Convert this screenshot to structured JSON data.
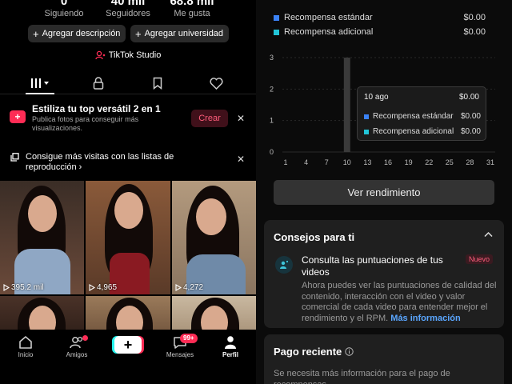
{
  "profile": {
    "stats": [
      {
        "value": "0",
        "label": "Siguiendo"
      },
      {
        "value": "40 mil",
        "label": "Seguidores"
      },
      {
        "value": "68.8 mil",
        "label": "Me gusta"
      }
    ],
    "add_description": "Agregar descripción",
    "add_university": "Agregar universidad",
    "studio_label": "TikTok Studio"
  },
  "promo": {
    "title": "Estiliza tu top versátil 2 en 1",
    "description": "Publica fotos para conseguir más visualizaciones.",
    "create_label": "Crear"
  },
  "playlist_banner": {
    "text": "Consigue más visitas con las listas de reproducción",
    "arrow": "›"
  },
  "videos": [
    {
      "views": "395.2 mil"
    },
    {
      "views": "4,965"
    },
    {
      "views": "4,272"
    },
    {
      "views": ""
    },
    {
      "views": ""
    },
    {
      "views": ""
    }
  ],
  "bottom_nav": {
    "items": [
      {
        "label": "Inicio",
        "icon": "home-icon"
      },
      {
        "label": "Amigos",
        "icon": "friends-icon"
      },
      {
        "label": "",
        "icon": "create-icon"
      },
      {
        "label": "Mensajes",
        "icon": "inbox-icon",
        "badge": "99+"
      },
      {
        "label": "Perfil",
        "icon": "profile-icon"
      }
    ]
  },
  "rewards": {
    "legend": [
      {
        "label": "Recompensa estándar",
        "value": "$0.00",
        "color": "#3b82f6"
      },
      {
        "label": "Recompensa adicional",
        "value": "$0.00",
        "color": "#22c5d8"
      }
    ],
    "tooltip": {
      "date": "10 ago",
      "total": "$0.00",
      "rows": [
        {
          "label": "Recompensa estándar",
          "value": "$0.00",
          "color": "#3b82f6"
        },
        {
          "label": "Recompensa adicional",
          "value": "$0.00",
          "color": "#22c5d8"
        }
      ]
    },
    "view_performance": "Ver rendimiento"
  },
  "chart_data": {
    "type": "bar",
    "x": [
      "1",
      "4",
      "7",
      "10",
      "13",
      "16",
      "19",
      "22",
      "25",
      "28",
      "31"
    ],
    "y_ticks": [
      "0",
      "1",
      "2",
      "3"
    ],
    "ylim": [
      0,
      3
    ],
    "series": [
      {
        "name": "Recompensa estándar",
        "values": [
          0,
          0,
          0,
          0,
          0,
          0,
          0,
          0,
          0,
          0,
          0
        ]
      },
      {
        "name": "Recompensa adicional",
        "values": [
          0,
          0,
          0,
          0,
          0,
          0,
          0,
          0,
          0,
          0,
          0
        ]
      }
    ],
    "highlighted_x": "10"
  },
  "tips": {
    "title": "Consejos para ti",
    "item_title": "Consulta las puntuaciones de tus videos",
    "new_badge": "Nuevo",
    "item_body": "Ahora puedes ver las puntuaciones de calidad del contenido, interacción con el video y valor comercial de cada video para entender mejor el rendimiento y el RPM.",
    "more_link": "Más información"
  },
  "recent_payment": {
    "title": "Pago reciente",
    "body": "Se necesita más información para el pago de recompensas"
  }
}
